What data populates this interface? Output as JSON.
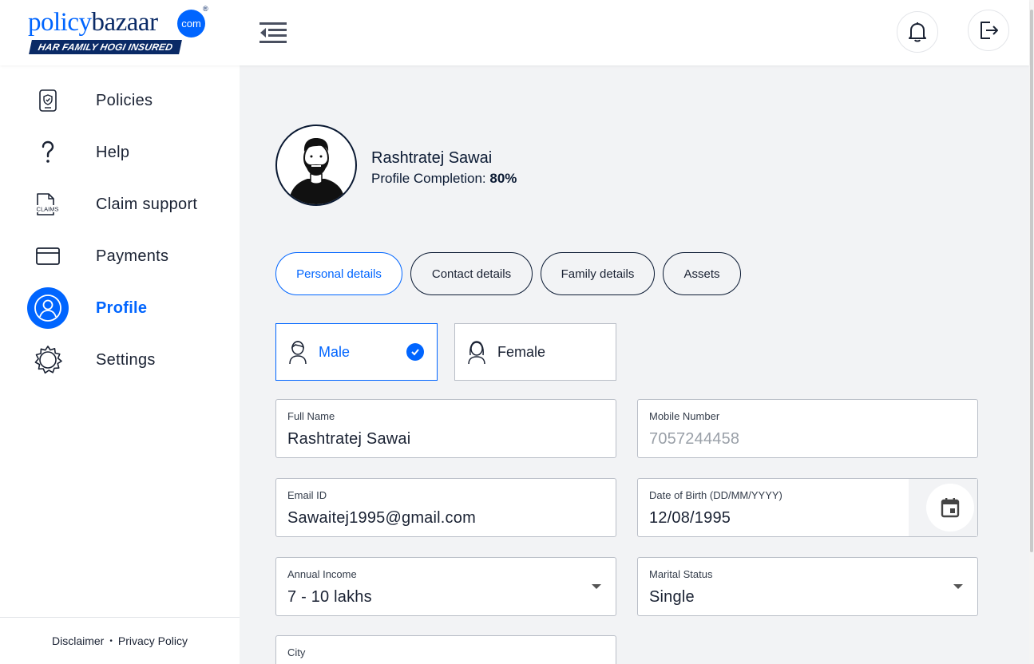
{
  "brand": {
    "name_part1": "policy",
    "name_part2": "bazaar",
    "suffix": "com",
    "registered": "®",
    "tagline": "HAR FAMILY HOGI INSURED"
  },
  "header": {
    "menu_icon": "menu-collapse-icon",
    "bell_icon": "bell-icon",
    "logout_icon": "logout-icon"
  },
  "sidebar": {
    "items": [
      {
        "label": "Policies",
        "icon": "policy-shield-icon",
        "active": false
      },
      {
        "label": "Help",
        "icon": "question-mark-icon",
        "active": false
      },
      {
        "label": "Claim support",
        "icon": "claims-document-icon",
        "active": false
      },
      {
        "label": "Payments",
        "icon": "card-icon",
        "active": false
      },
      {
        "label": "Profile",
        "icon": "user-icon",
        "active": true
      },
      {
        "label": "Settings",
        "icon": "gear-icon",
        "active": false
      }
    ],
    "footer": {
      "disclaimer": "Disclaimer",
      "separator": "•",
      "privacy": "Privacy Policy"
    }
  },
  "profile": {
    "name": "Rashtratej Sawai",
    "completion_label": "Profile Completion:",
    "completion_value": "80%"
  },
  "tabs": [
    {
      "label": "Personal details",
      "active": true
    },
    {
      "label": "Contact details",
      "active": false
    },
    {
      "label": "Family details",
      "active": false
    },
    {
      "label": "Assets",
      "active": false
    }
  ],
  "gender": {
    "male": "Male",
    "female": "Female",
    "selected": "Male"
  },
  "form": {
    "full_name": {
      "label": "Full Name",
      "value": "Rashtratej Sawai"
    },
    "mobile": {
      "label": "Mobile Number",
      "value": "7057244458"
    },
    "email": {
      "label": "Email ID",
      "value": "Sawaitej1995@gmail.com"
    },
    "dob": {
      "label": "Date of Birth (DD/MM/YYYY)",
      "value": "12/08/1995"
    },
    "income": {
      "label": "Annual Income",
      "value": "7 - 10 lakhs"
    },
    "marital": {
      "label": "Marital Status",
      "value": "Single"
    },
    "city": {
      "label": "City",
      "value": ""
    }
  },
  "colors": {
    "accent": "#0065ff",
    "navy": "#0a2a66",
    "background": "#f2f3f5"
  }
}
